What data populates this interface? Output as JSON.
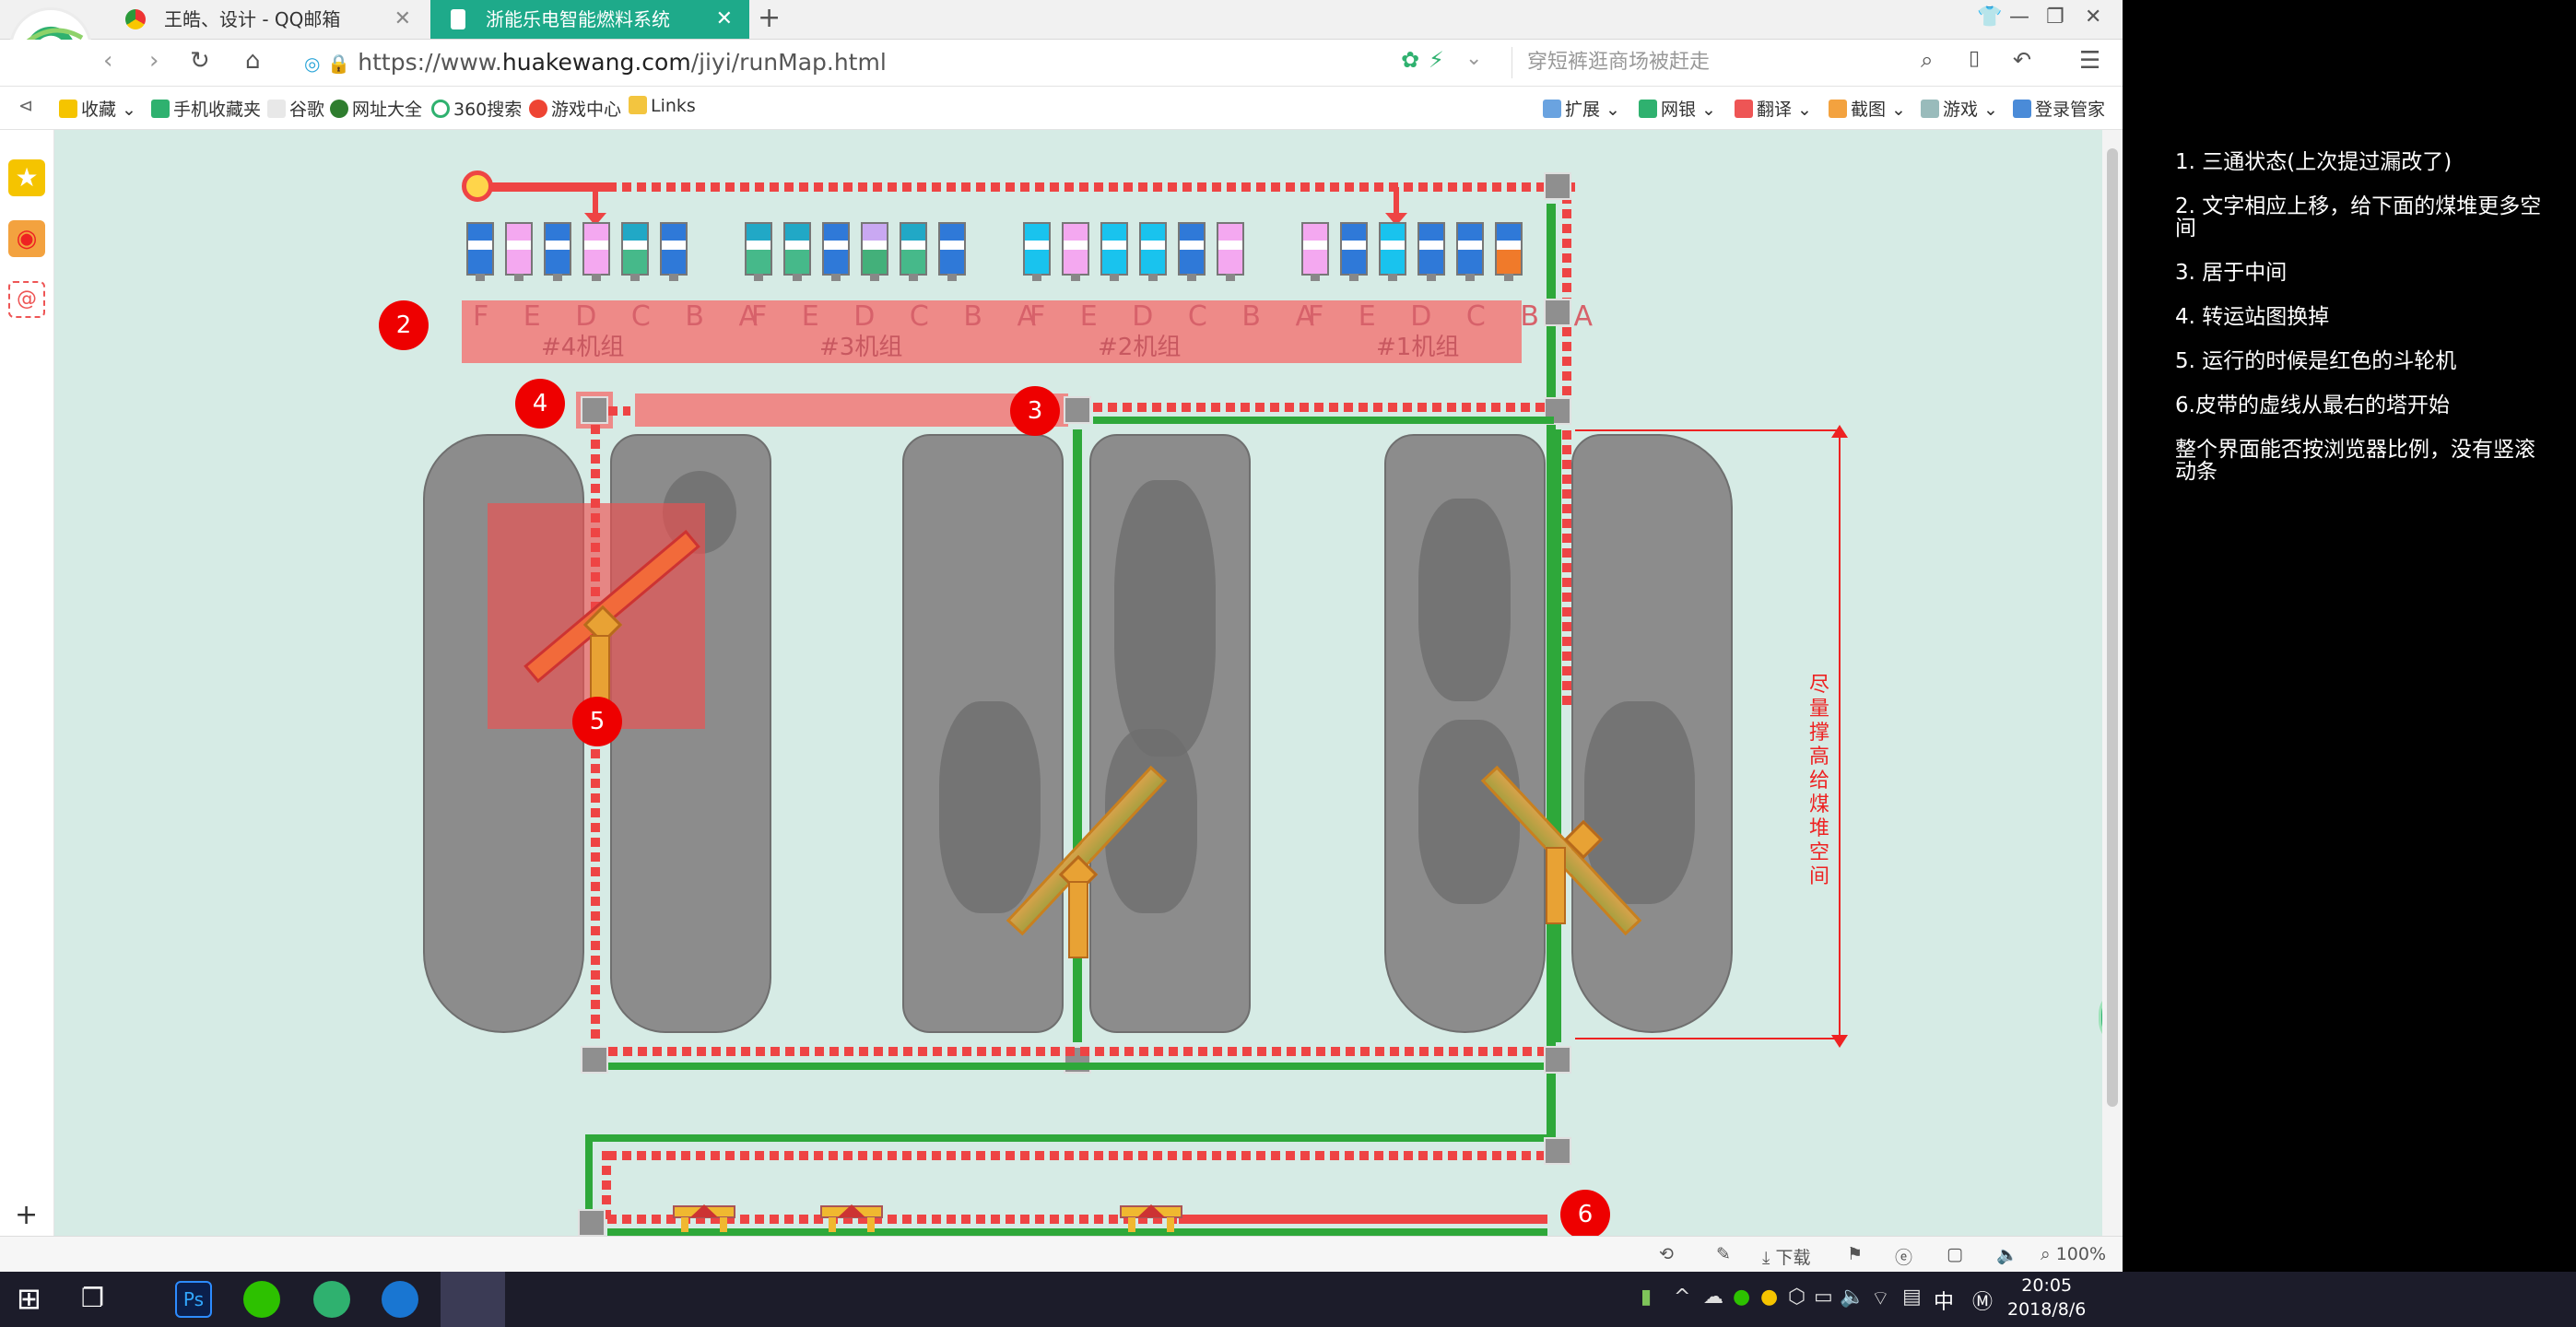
{
  "browser": {
    "tabs": [
      {
        "label": "王皓、设计 - QQ邮箱",
        "active": false
      },
      {
        "label": "浙能乐电智能燃料系统",
        "active": true
      }
    ],
    "new_tab": "+",
    "url_prefix": "https://www.",
    "url_domain": "huakewang.com",
    "url_path": "/jiyi/runMap.html",
    "search_placeholder": "穿短裤逛商场被赶走",
    "bookmarks": [
      "收藏",
      "手机收藏夹",
      "谷歌",
      "网址大全",
      "360搜索",
      "游戏中心",
      "Links"
    ],
    "toolbar_right": [
      "扩展",
      "网银",
      "翻译",
      "截图",
      "游戏",
      "登录管家"
    ],
    "status_download": "下载",
    "zoom": "100%",
    "colors": {
      "tab_active": "#1eaa8a",
      "accent": "#2fb16f"
    }
  },
  "map": {
    "units": [
      {
        "name": "#4机组",
        "letters": "F E D C B A"
      },
      {
        "name": "#3机组",
        "letters": "F E D C B A"
      },
      {
        "name": "#2机组",
        "letters": "F E D C B A"
      },
      {
        "name": "#1机组",
        "letters": "F E D C B A"
      }
    ],
    "bunkers": [
      [
        "blue",
        "pink",
        "blue",
        "pink",
        "teal",
        "blue"
      ],
      [
        "teal",
        "teal",
        "blue",
        "green",
        "teal",
        "blue"
      ],
      [
        "cyan",
        "pink",
        "cyan",
        "cyan",
        "blue",
        "pink"
      ],
      [
        "pink",
        "blue",
        "cyan",
        "blue",
        "blue",
        "orange"
      ]
    ],
    "markers": [
      "2",
      "4",
      "3",
      "5",
      "6"
    ],
    "vertical_note": "尽量撑高给煤堆空间",
    "colors": {
      "running": "#ee4444",
      "idle": "#2ea83a",
      "background": "#d6ebe5"
    }
  },
  "notes": [
    "1. 三通状态(上次提过漏改了)",
    "2. 文字相应上移，给下面的煤堆更多空间",
    "3. 居于中间",
    "4. 转运站图换掉",
    "5. 运行的时候是红色的斗轮机",
    "6.皮带的虚线从最右的塔开始",
    "整个界面能否按浏览器比例，没有竖滚动条"
  ],
  "taskbar": {
    "time": "20:05",
    "date": "2018/8/6",
    "ime": "中",
    "ps_label": "Ps"
  }
}
